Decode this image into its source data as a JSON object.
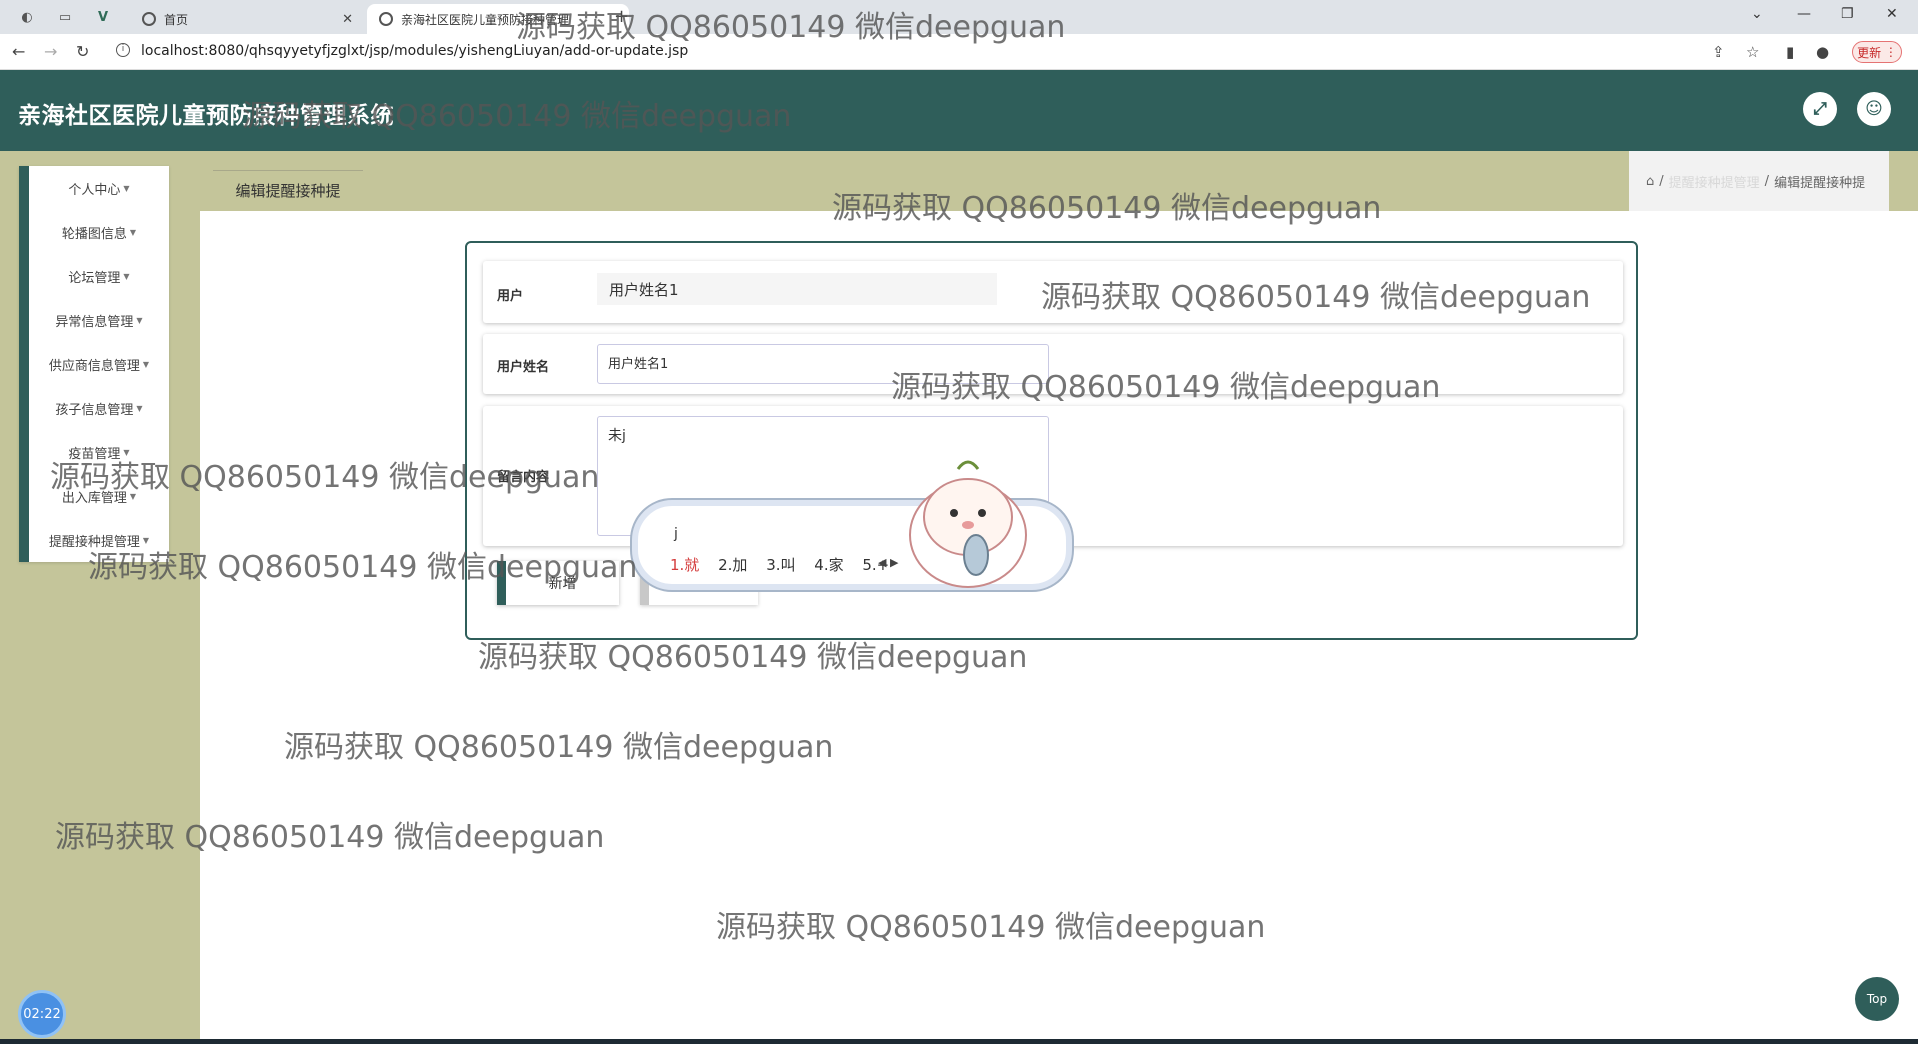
{
  "browser": {
    "tabs": [
      {
        "label": "首页",
        "active": false
      },
      {
        "label": "亲海社区医院儿童预防接种管理",
        "active": true
      }
    ],
    "url": "localhost:8080/qhsqyyetyfjzglxt/jsp/modules/yishengLiuyan/add-or-update.jsp",
    "update_label": "更新"
  },
  "app": {
    "title": "亲海社区医院儿童预防接种管理系统",
    "accent_color": "#2f5e5a",
    "background_color": "#c4c59a"
  },
  "sidebar": {
    "items": [
      {
        "label": "个人中心"
      },
      {
        "label": "轮播图信息"
      },
      {
        "label": "论坛管理"
      },
      {
        "label": "异常信息管理"
      },
      {
        "label": "供应商信息管理"
      },
      {
        "label": "孩子信息管理"
      },
      {
        "label": "疫苗管理"
      },
      {
        "label": "出入库管理"
      },
      {
        "label": "提醒接种提管理"
      }
    ]
  },
  "page": {
    "label": "编辑提醒接种提"
  },
  "breadcrumb": {
    "parent": "提醒接种提管理",
    "current": "编辑提醒接种提"
  },
  "form": {
    "user_label": "用户",
    "user_value": "用户姓名1",
    "username_label": "用户姓名",
    "username_value": "用户姓名1",
    "message_label": "留言内容",
    "message_value": "未j",
    "add_button": "新增"
  },
  "ime": {
    "composition": "j",
    "candidates": [
      "1.就",
      "2.加",
      "3.叫",
      "4.家",
      "5.+"
    ]
  },
  "widgets": {
    "timer": "02:22",
    "top_button": "Top"
  },
  "watermark": "源码获取 QQ86050149 微信deepguan"
}
